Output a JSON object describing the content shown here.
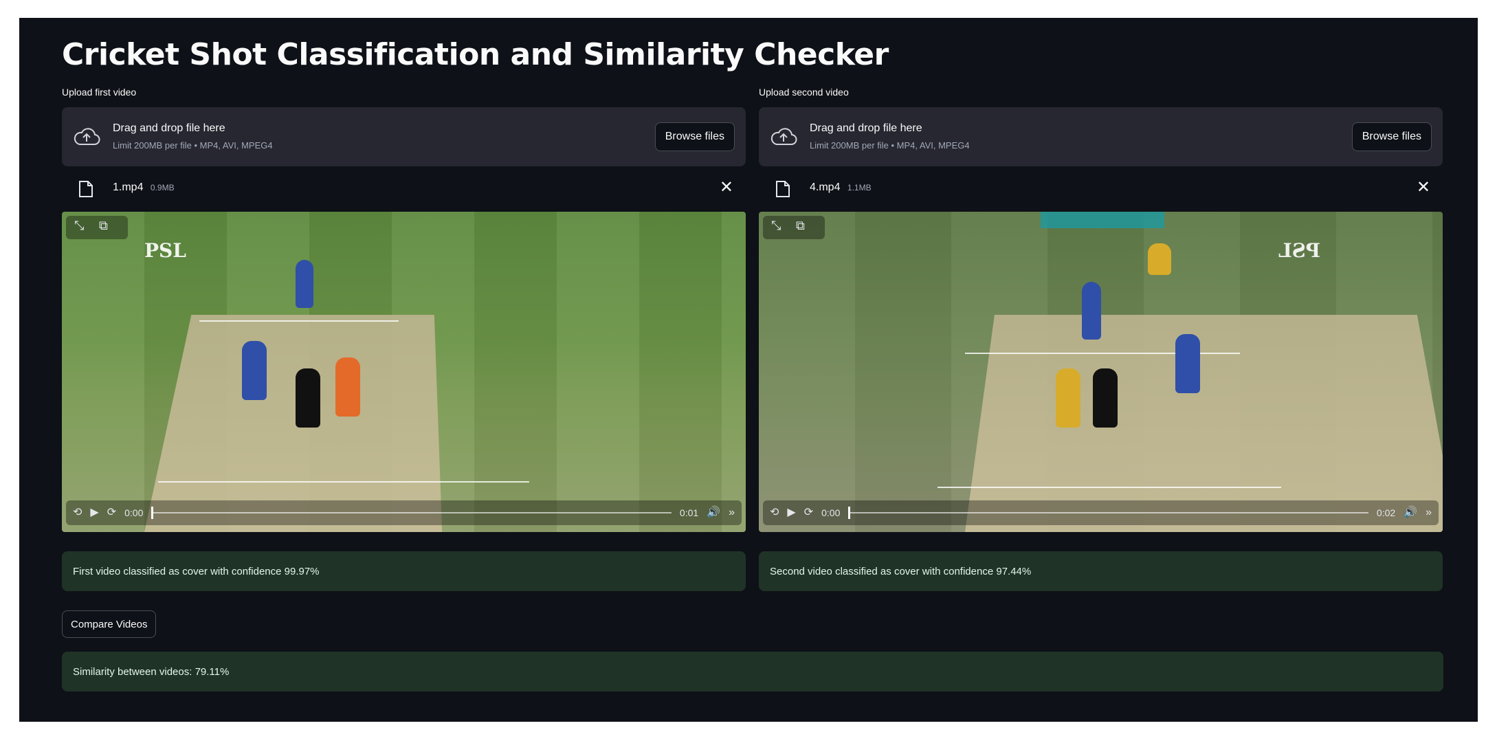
{
  "page": {
    "title": "Cricket Shot Classification and Similarity Checker"
  },
  "uploaders": [
    {
      "label": "Upload first video",
      "drop_text": "Drag and drop file here",
      "limit_text": "Limit 200MB per file • MP4, AVI, MPEG4",
      "browse_label": "Browse files",
      "file_name": "1.mp4",
      "file_size": "0.9MB",
      "close_glyph": "✕",
      "video": {
        "logo": "PSL",
        "current_time": "0:00",
        "duration": "0:01",
        "progress": 0
      },
      "result": "First video classified as cover with confidence 99.97%"
    },
    {
      "label": "Upload second video",
      "drop_text": "Drag and drop file here",
      "limit_text": "Limit 200MB per file • MP4, AVI, MPEG4",
      "browse_label": "Browse files",
      "file_name": "4.mp4",
      "file_size": "1.1MB",
      "close_glyph": "✕",
      "video": {
        "logo": "PSL",
        "current_time": "0:00",
        "duration": "0:02",
        "progress": 0
      },
      "result": "Second video classified as cover with confidence 97.44%"
    }
  ],
  "icons": {
    "upload": "cloud-upload-icon",
    "file": "file-icon",
    "close": "close-icon",
    "fullscreen": "fullscreen-icon",
    "pip": "picture-in-picture-icon",
    "rewind": "rewind-icon",
    "play": "play-icon",
    "forward": "forward-icon",
    "volume": "volume-icon",
    "more": "more-icon"
  },
  "compare_button": {
    "label": "Compare Videos"
  },
  "similarity": {
    "text": "Similarity between videos: 79.11%"
  },
  "colors": {
    "background": "#0e1117",
    "panel": "#262730",
    "success_bg": "#1f3327",
    "success_text": "#e6f6ea"
  }
}
